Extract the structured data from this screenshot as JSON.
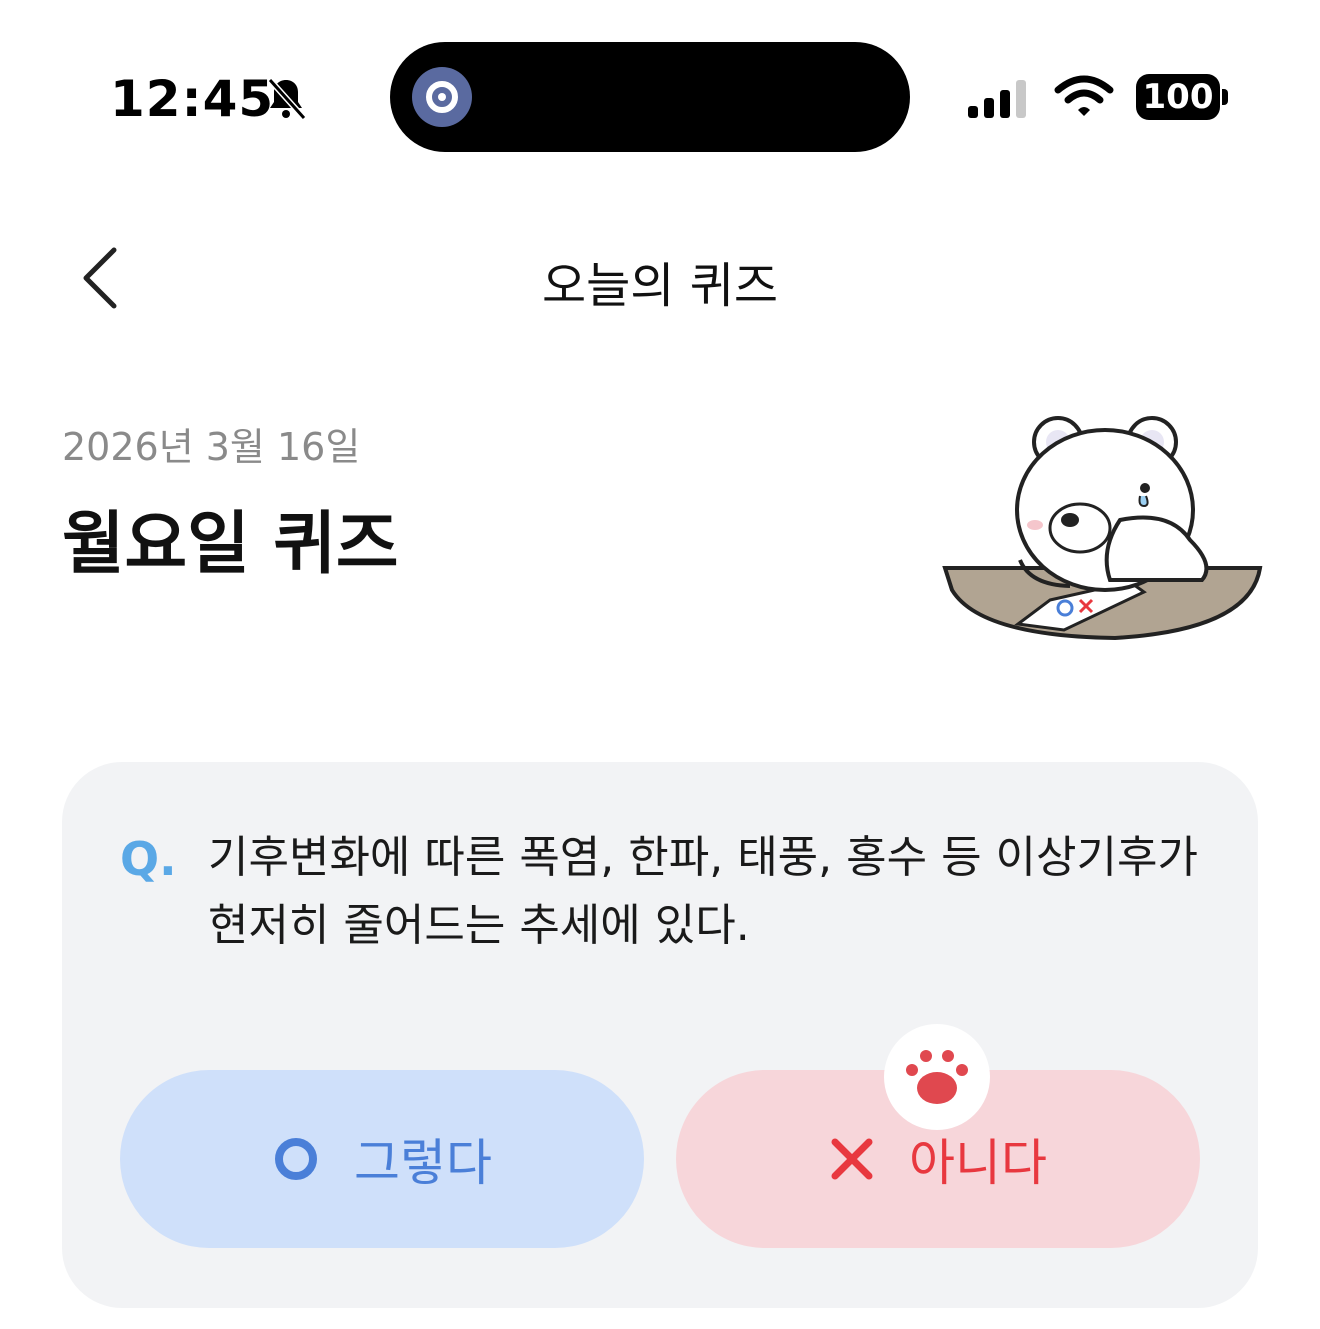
{
  "status_bar": {
    "time": "12:45",
    "icons": [
      "bell-slash-icon",
      "signal-icon",
      "wifi-icon",
      "battery-icon"
    ],
    "battery": "100"
  },
  "nav": {
    "title": "오늘의 퀴즈",
    "back_icon": "chevron-left-icon"
  },
  "header": {
    "date": "2026년 3월 16일",
    "title": "월요일 퀴즈",
    "illustration": "bear-with-ox-paper-illustration"
  },
  "quiz": {
    "q_mark": "Q.",
    "question": "기후변화에 따른 폭염, 한파, 태풍, 홍수 등 이상기후가\n현저히 줄어드는 추세에 있다.",
    "answer_yes": {
      "icon": "circle-o-icon",
      "label": "그렇다",
      "color": "#4a7fd8"
    },
    "answer_no": {
      "icon": "x-icon",
      "label": "아니다",
      "color": "#e8383f"
    },
    "paw_icon": "paw-icon"
  },
  "colors": {
    "accent_blue": "#5aa8e6",
    "yes_bg": "#cfe0fa",
    "no_bg": "#f7d6da",
    "card_bg": "#f2f3f5"
  }
}
